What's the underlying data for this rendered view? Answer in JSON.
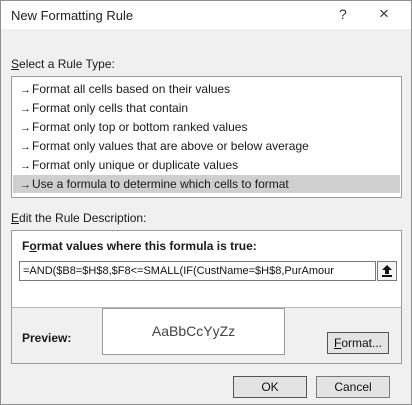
{
  "dialog": {
    "title": "New Formatting Rule",
    "help_label": "?",
    "close_label": "×"
  },
  "rule_type": {
    "label_hotkey": "S",
    "label_rest": "elect a Rule Type:",
    "items": [
      {
        "label": "Format all cells based on their values",
        "selected": false
      },
      {
        "label": "Format only cells that contain",
        "selected": false
      },
      {
        "label": "Format only top or bottom ranked values",
        "selected": false
      },
      {
        "label": "Format only values that are above or below average",
        "selected": false
      },
      {
        "label": "Format only unique or duplicate values",
        "selected": false
      },
      {
        "label": "Use a formula to determine which cells to format",
        "selected": true
      }
    ]
  },
  "description": {
    "label_hotkey": "E",
    "label_rest": "dit the Rule Description:",
    "formula_label_pre": "F",
    "formula_label_hotkey": "o",
    "formula_label_rest": "rmat values where this formula is true:",
    "formula_value": "=AND($B8=$H$8,$F8<=SMALL(IF(CustName=$H$8,PurAmour",
    "preview_label": "Preview:",
    "preview_text": "AaBbCcYyZz",
    "format_button_hotkey": "F",
    "format_button_rest": "ormat..."
  },
  "buttons": {
    "ok": "OK",
    "cancel": "Cancel"
  },
  "colors": {
    "selected_row": "#cfcfcf",
    "dialog_bg": "#f0f0f0"
  }
}
